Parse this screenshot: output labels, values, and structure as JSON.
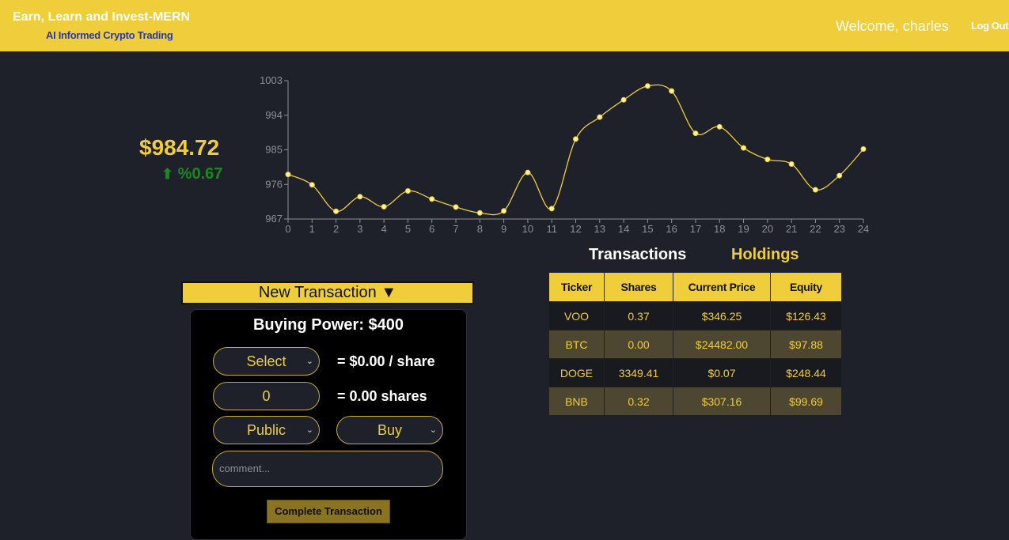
{
  "header": {
    "title": "Earn, Learn and Invest-MERN",
    "subtitle": "AI Informed Crypto Trading",
    "welcome": "Welcome, charles",
    "logout_label": "Log Out"
  },
  "price": {
    "value": "$984.72",
    "change_arrow": "⬆",
    "change": "%0.67"
  },
  "colors": {
    "accent": "#f0cd3a",
    "background": "#1e2129",
    "positive": "#1a8a1e",
    "header_subtitle": "#2c3a9c"
  },
  "chart_data": {
    "type": "line",
    "x": [
      0,
      1,
      2,
      3,
      4,
      5,
      6,
      7,
      8,
      9,
      10,
      11,
      12,
      13,
      14,
      15,
      16,
      17,
      18,
      19,
      20,
      21,
      22,
      23,
      24
    ],
    "y": [
      978.6,
      975.9,
      969.0,
      972.8,
      970.2,
      974.3,
      972.2,
      970.1,
      968.6,
      969.1,
      979.1,
      969.7,
      987.8,
      993.5,
      998.0,
      1001.6,
      1000.3,
      989.3,
      991.0,
      985.5,
      982.5,
      981.3,
      974.6,
      978.3,
      985.2
    ],
    "ylim": [
      967,
      1003
    ],
    "xlim": [
      0,
      24
    ],
    "yticks": [
      967,
      976,
      985,
      994,
      1003
    ],
    "xticks": [
      0,
      1,
      2,
      3,
      4,
      5,
      6,
      7,
      8,
      9,
      10,
      11,
      12,
      13,
      14,
      15,
      16,
      17,
      18,
      19,
      20,
      21,
      22,
      23,
      24
    ],
    "color": "#f0cd3a",
    "grid": false
  },
  "tabs": {
    "transactions": "Transactions",
    "holdings": "Holdings"
  },
  "holdings": {
    "columns": [
      "Ticker",
      "Shares",
      "Current Price",
      "Equity"
    ],
    "rows": [
      [
        "VOO",
        "0.37",
        "$346.25",
        "$126.43"
      ],
      [
        "BTC",
        "0.00",
        "$24482.00",
        "$97.88"
      ],
      [
        "DOGE",
        "3349.41",
        "$0.07",
        "$248.44"
      ],
      [
        "BNB",
        "0.32",
        "$307.16",
        "$99.69"
      ]
    ]
  },
  "new_transaction": {
    "toggle_label": "New Transaction ▼",
    "buying_power": "Buying Power: $400",
    "ticker_select": "Select",
    "price_per_share": "= $0.00 / share",
    "quantity_value": "0",
    "shares_text": "= 0.00 shares",
    "visibility_select": "Public",
    "side_select": "Buy",
    "comment_placeholder": "comment...",
    "submit_label": "Complete Transaction"
  }
}
